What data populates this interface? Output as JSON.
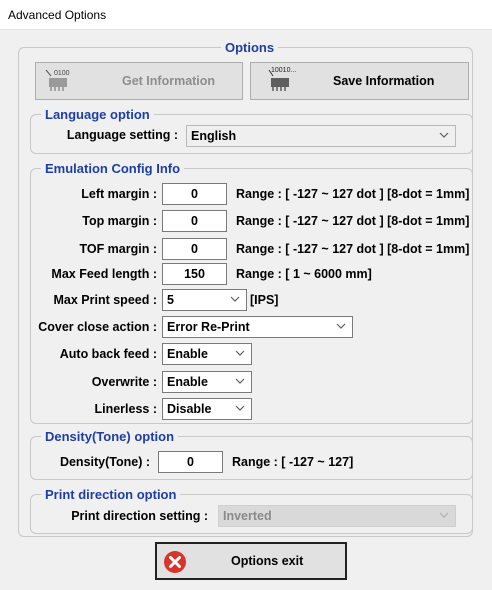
{
  "window": {
    "title": "Advanced Options"
  },
  "options_group": {
    "legend": "Options"
  },
  "buttons": {
    "get_info": "Get Information",
    "get_info_icon_text": "0100",
    "save_info": "Save Information",
    "save_info_icon_text": "10010..."
  },
  "language": {
    "legend": "Language option",
    "label": "Language setting :",
    "value": "English"
  },
  "emulation": {
    "legend": "Emulation Config Info",
    "left_margin": {
      "label": "Left margin :",
      "value": "0",
      "range": "Range : [ -127 ~ 127 dot ] [8-dot = 1mm]"
    },
    "top_margin": {
      "label": "Top margin :",
      "value": "0",
      "range": "Range : [ -127 ~ 127 dot ] [8-dot = 1mm]"
    },
    "tof_margin": {
      "label": "TOF margin :",
      "value": "0",
      "range": "Range : [ -127 ~ 127 dot ] [8-dot = 1mm]"
    },
    "max_feed": {
      "label": "Max Feed length :",
      "value": "150",
      "range": "Range : [ 1 ~ 6000 mm]"
    },
    "max_speed": {
      "label": "Max Print speed :",
      "value": "5",
      "unit": "[IPS]"
    },
    "cover_close": {
      "label": "Cover close action :",
      "value": "Error Re-Print"
    },
    "auto_back_feed": {
      "label": "Auto back feed :",
      "value": "Enable"
    },
    "overwrite": {
      "label": "Overwrite :",
      "value": "Enable"
    },
    "linerless": {
      "label": "Linerless :",
      "value": "Disable"
    }
  },
  "density": {
    "legend": "Density(Tone) option",
    "label": "Density(Tone) :",
    "value": "0",
    "range": "Range : [ -127 ~ 127]"
  },
  "print_direction": {
    "legend": "Print direction option",
    "label": "Print direction setting :",
    "value": "Inverted"
  },
  "exit": {
    "label": "Options exit"
  },
  "colors": {
    "legend": "#1f3ea3",
    "exit_icon": "#d9342b"
  }
}
